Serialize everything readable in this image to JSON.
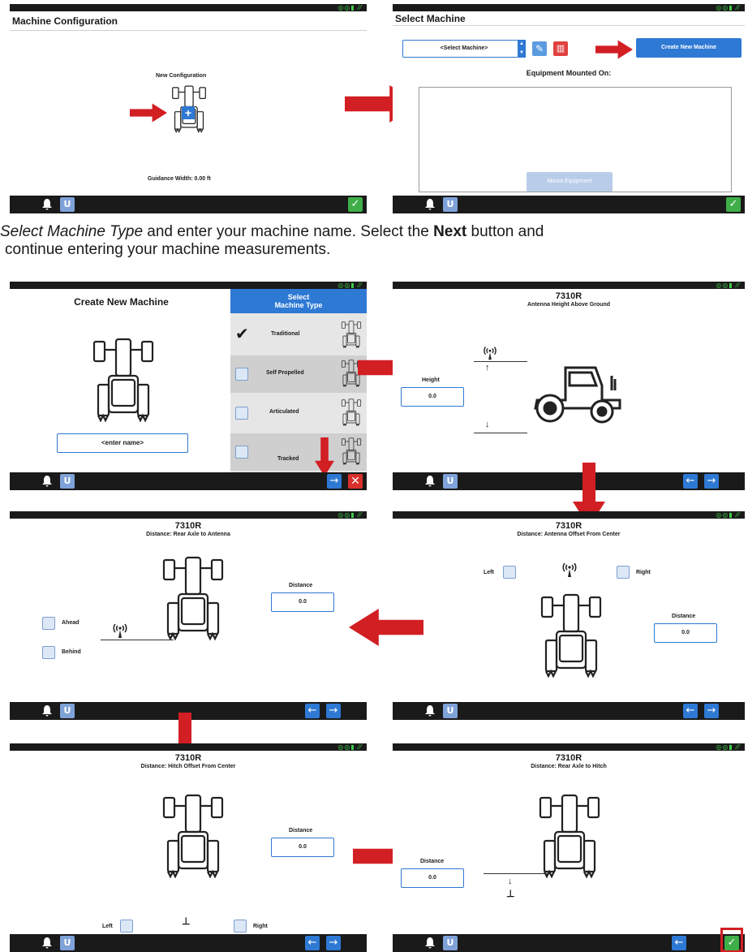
{
  "colors": {
    "accent": "#2e79d4",
    "ok": "#3fae49",
    "cancel": "#d9302c",
    "arrow": "#d21f24",
    "bar": "#1a1a1a"
  },
  "caption": {
    "line1_pre": "Select Machine Type",
    "line1_post": " and enter your machine name.  Select the ",
    "line1_bold": "Next",
    "line1_end": " button and",
    "line2": "continue entering your machine measurements."
  },
  "s1": {
    "title": "Machine Configuration",
    "new_config": "New Configuration",
    "guidance": "Guidance Width:  0.00 ft"
  },
  "s2": {
    "title": "Select Machine",
    "select_value": "<Select Machine>",
    "create_btn": "Create New Machine",
    "mounted_label": "Equipment Mounted On:",
    "mount_btn": "Mount Equipment"
  },
  "s3": {
    "title": "Create New Machine",
    "name_placeholder": "<enter name>",
    "type_header": "Select\nMachine Type",
    "types": [
      {
        "label": "Traditional",
        "checked": true
      },
      {
        "label": "Self Propelled",
        "checked": false
      },
      {
        "label": "Articulated",
        "checked": false
      },
      {
        "label": "Tracked",
        "checked": false
      }
    ]
  },
  "s4": {
    "machine": "7310R",
    "subtitle": "Antenna Height Above Ground",
    "field_label": "Height",
    "value": "0.0"
  },
  "s5": {
    "machine": "7310R",
    "subtitle": "Distance: Antenna Offset From Center",
    "left": "Left",
    "right": "Right",
    "field_label": "Distance",
    "value": "0.0"
  },
  "s6": {
    "machine": "7310R",
    "subtitle": "Distance: Rear Axle to Antenna",
    "field_label": "Distance",
    "value": "0.0",
    "ahead": "Ahead",
    "behind": "Behind"
  },
  "s7": {
    "machine": "7310R",
    "subtitle": "Distance: Hitch Offset From Center",
    "field_label": "Distance",
    "value": "0.0",
    "left": "Left",
    "right": "Right"
  },
  "s8": {
    "machine": "7310R",
    "subtitle": "Distance: Rear Axle to Hitch",
    "field_label": "Distance",
    "value": "0.0"
  },
  "statusbar": {
    "indicators": "GPS • signal"
  },
  "icons": {
    "bell": "bell-icon",
    "ut": "ut-icon",
    "next": "arrow-right-icon",
    "back": "arrow-left-icon",
    "ok": "check-icon",
    "cancel": "close-icon"
  }
}
